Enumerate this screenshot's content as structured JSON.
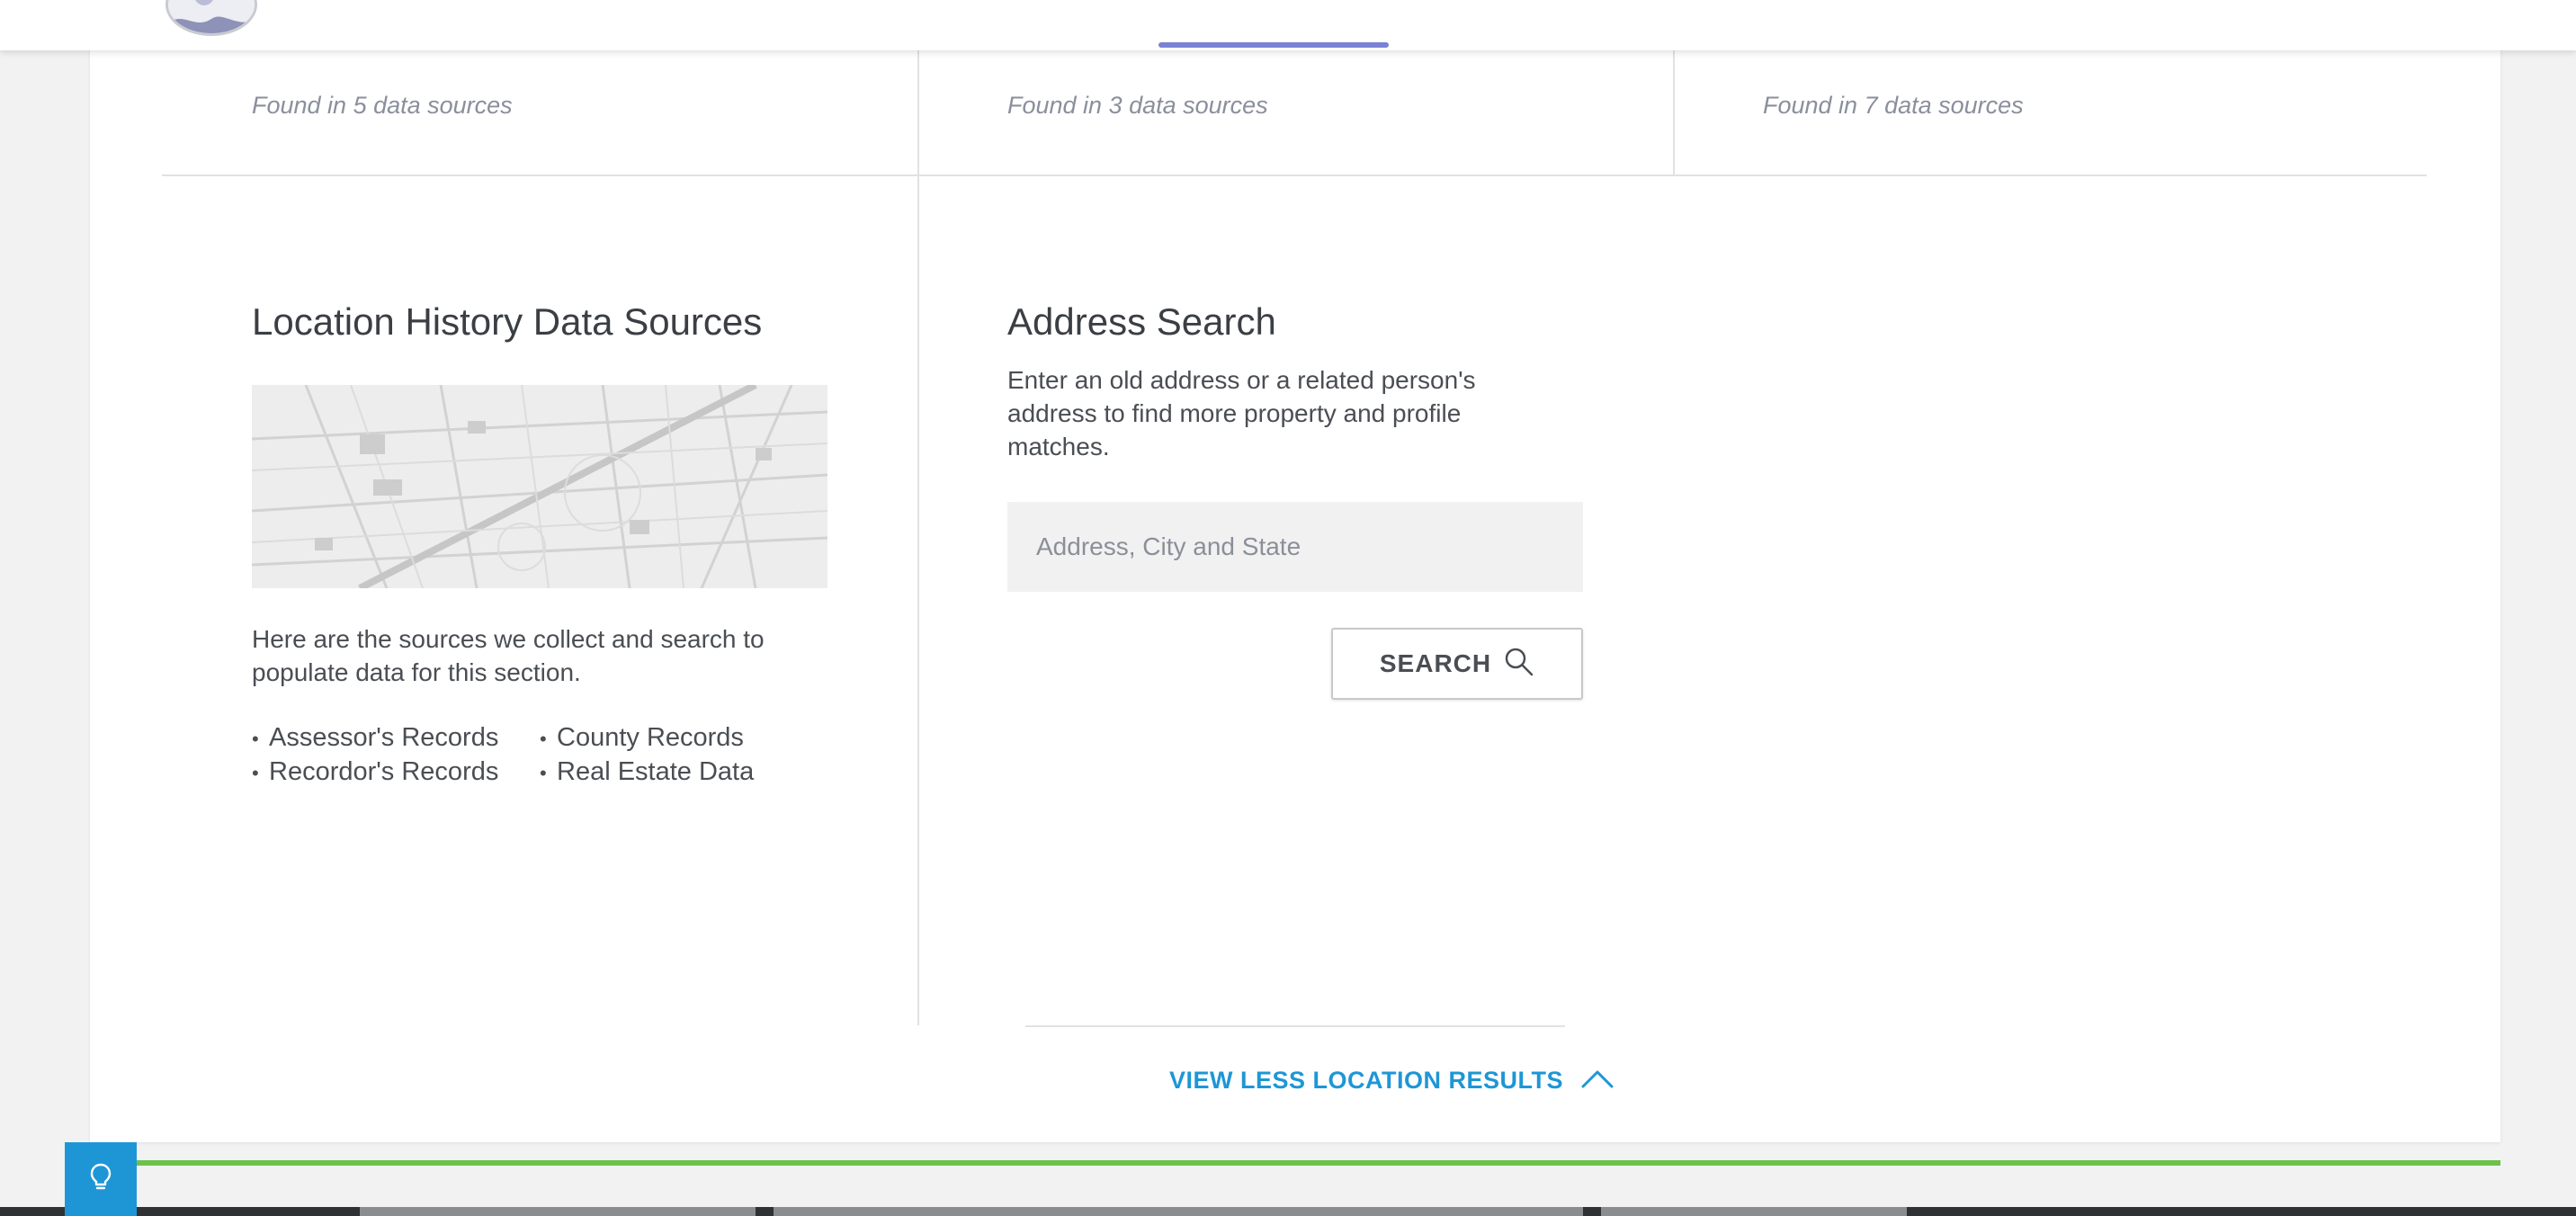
{
  "colors": {
    "accent_blue": "#1e96d6",
    "active_tab": "#7b82d4",
    "divider_green": "#6cc24a"
  },
  "summary": {
    "found_texts": [
      "Found in 5 data sources",
      "Found in 3 data sources",
      "Found in 7 data sources"
    ]
  },
  "location_sources": {
    "heading": "Location History Data Sources",
    "description": "Here are the sources we collect and search to populate data for this section.",
    "sources": [
      "Assessor's Records",
      "Recordor's Records",
      "County Records",
      "Real Estate Data"
    ]
  },
  "address_search": {
    "heading": "Address Search",
    "description": "Enter an old address or a related person's address to find more property and profile matches.",
    "placeholder": "Address, City and State",
    "value": "",
    "button_label": "SEARCH",
    "button_icon": "magnifier-icon"
  },
  "view_less": {
    "label": "VIEW LESS LOCATION RESULTS",
    "icon": "chevron-up-icon"
  },
  "hint_button": {
    "icon": "lightbulb-icon"
  }
}
